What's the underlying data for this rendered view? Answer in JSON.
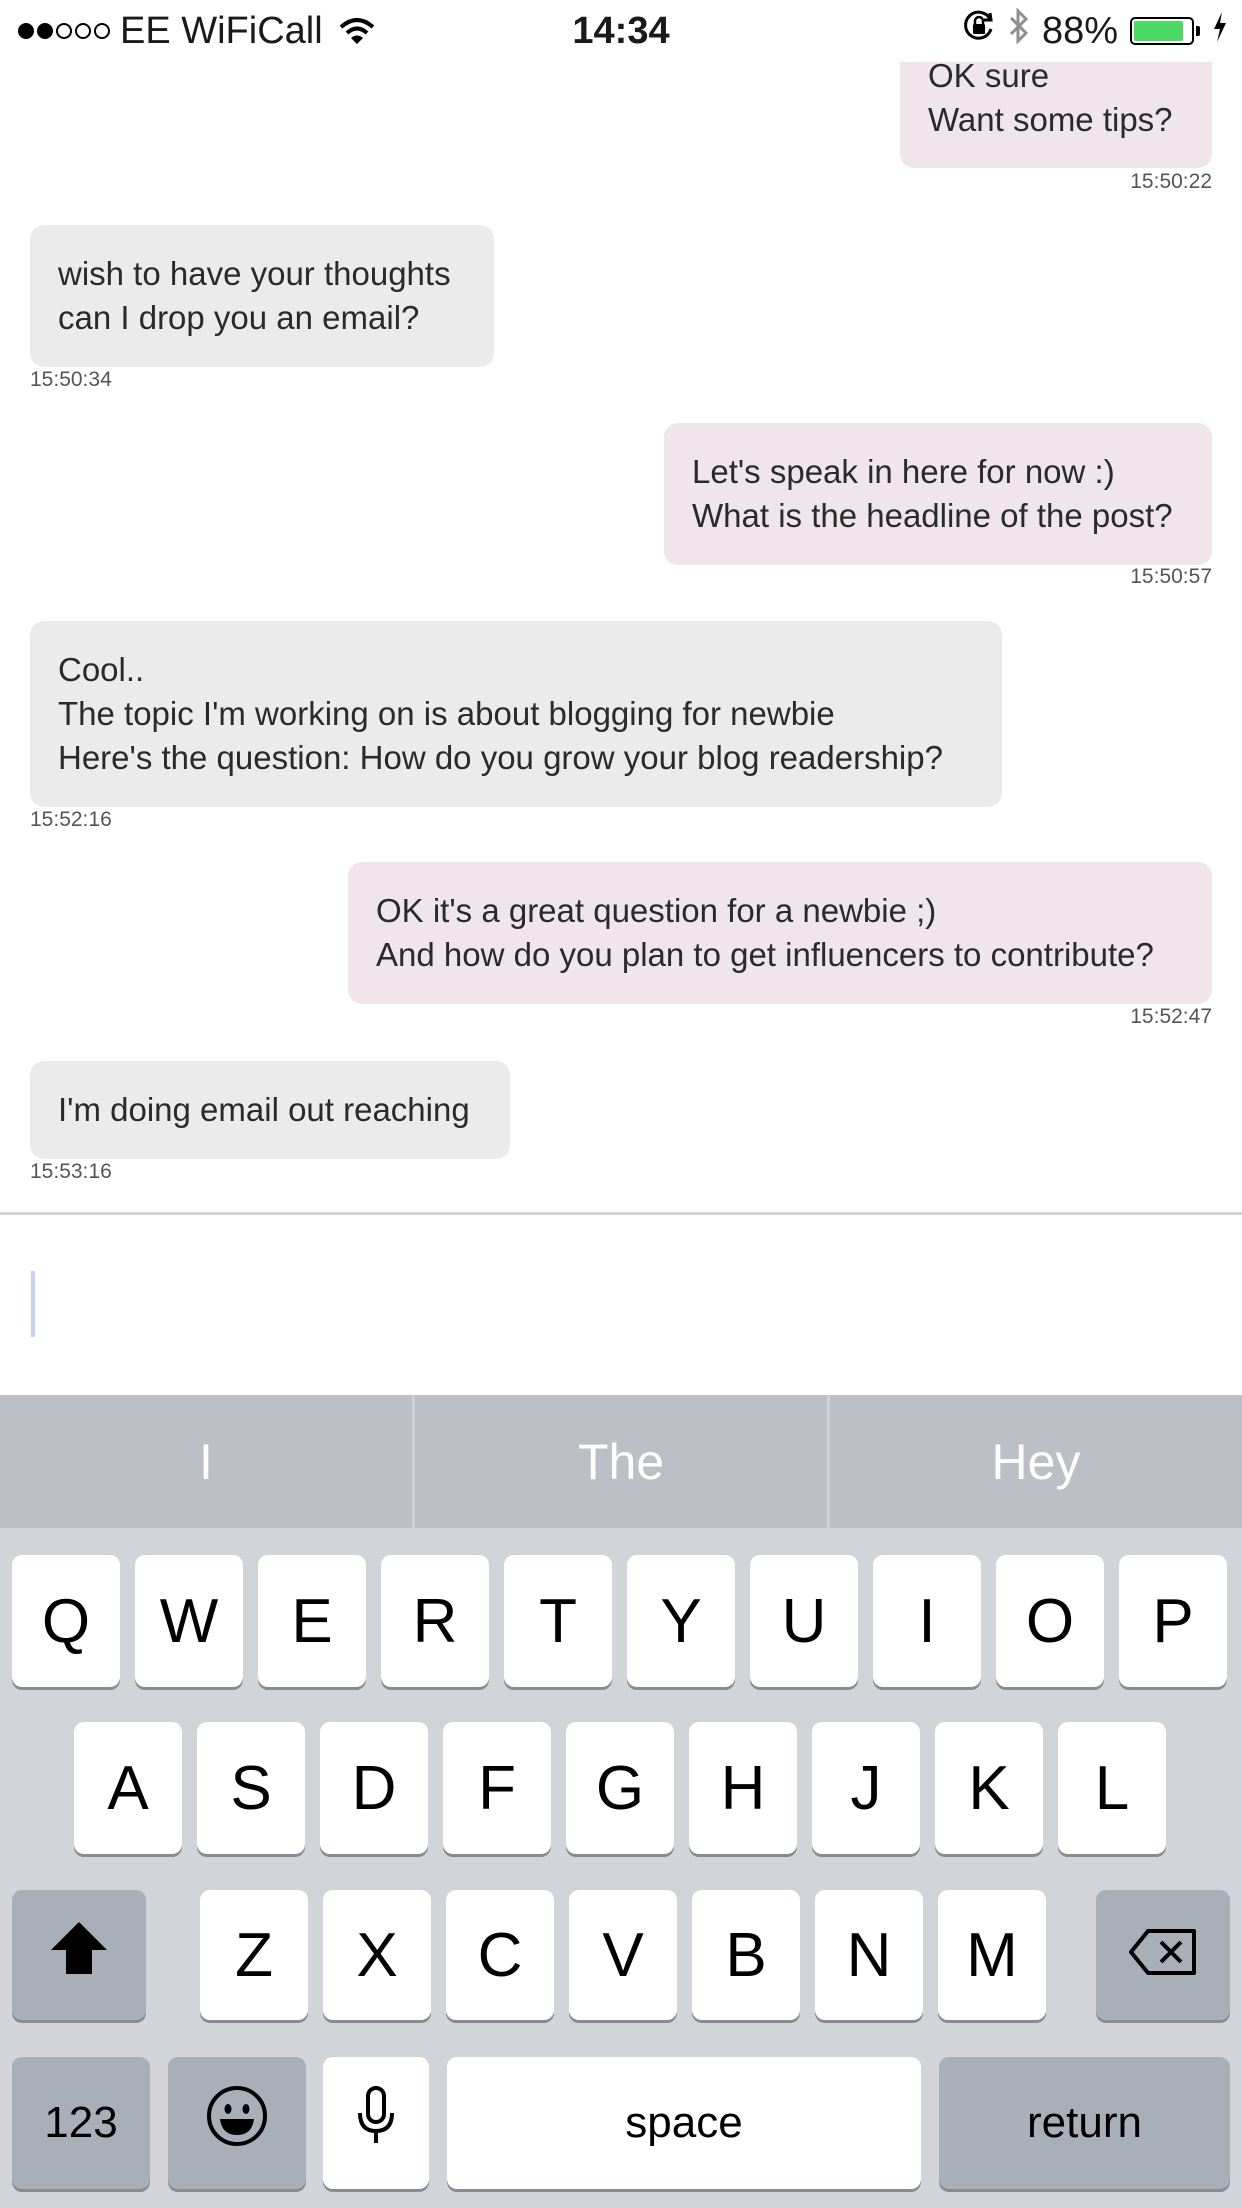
{
  "status_bar": {
    "carrier": "EE WiFiCall",
    "time": "14:34",
    "battery": "88%",
    "battery_level": 0.88,
    "colors": {
      "battery_fill": "#4cd964"
    }
  },
  "messages": [
    {
      "direction": "out",
      "lines": [
        "OK sure",
        "Want some tips?"
      ],
      "time": "15:50:22"
    },
    {
      "direction": "in",
      "lines": [
        "wish to have your thoughts",
        "can I drop you an email?"
      ],
      "time": "15:50:34"
    },
    {
      "direction": "out",
      "lines": [
        "Let's speak in here for now :)",
        "What is the headline of the post?"
      ],
      "time": "15:50:57"
    },
    {
      "direction": "in",
      "lines": [
        "Cool..",
        "The topic I'm working on is about blogging for newbie",
        "Here's the question: How do you grow your blog readership?"
      ],
      "time": "15:52:16"
    },
    {
      "direction": "out",
      "lines": [
        "OK it's a great question for a newbie ;)",
        "And how do you plan to get influencers to contribute?"
      ],
      "time": "15:52:47"
    },
    {
      "direction": "in",
      "lines": [
        "I'm doing email out reaching"
      ],
      "time": "15:53:16"
    }
  ],
  "composer": {
    "value": ""
  },
  "keyboard": {
    "suggestions": [
      "I",
      "The",
      "Hey"
    ],
    "row1": [
      "Q",
      "W",
      "E",
      "R",
      "T",
      "Y",
      "U",
      "I",
      "O",
      "P"
    ],
    "row2": [
      "A",
      "S",
      "D",
      "F",
      "G",
      "H",
      "J",
      "K",
      "L"
    ],
    "row3": [
      "Z",
      "X",
      "C",
      "V",
      "B",
      "N",
      "M"
    ],
    "numbers_label": "123",
    "space_label": "space",
    "return_label": "return",
    "icons": [
      "shift-icon",
      "backspace-icon",
      "emoji-icon",
      "microphone-icon"
    ]
  },
  "colors": {
    "incoming_bubble": "#ebebeb",
    "outgoing_bubble": "#efe5ea",
    "keyboard_bg": "#d1d4d9",
    "suggestion_bar": "#bcc0c6"
  }
}
